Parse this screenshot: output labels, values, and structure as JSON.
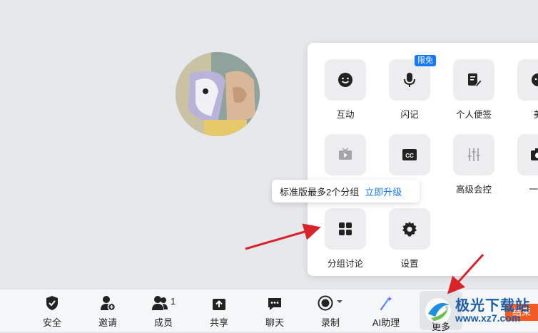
{
  "panel": {
    "tiles": [
      {
        "label": "互动",
        "icon": "smile-icon"
      },
      {
        "label": "闪记",
        "icon": "mic-icon",
        "badge": "限免"
      },
      {
        "label": "个人便签",
        "icon": "note-edit-icon"
      },
      {
        "label": "美",
        "icon": "beauty-icon"
      },
      {
        "label": "",
        "icon": "tv-play-icon"
      },
      {
        "label": "",
        "icon": "cc-icon"
      },
      {
        "label": "高级会控",
        "icon": "sliders-icon"
      },
      {
        "label": "一键",
        "icon": "camera-icon"
      },
      {
        "label": "分组讨论",
        "icon": "grid-icon"
      },
      {
        "label": "设置",
        "icon": "gear-icon"
      }
    ]
  },
  "tooltip": {
    "text": "标准版最多2个分组",
    "link": "立即升级"
  },
  "toolbar": {
    "items": [
      {
        "label": "安全",
        "icon": "shield-check-icon"
      },
      {
        "label": "邀请",
        "icon": "add-user-icon"
      },
      {
        "label": "成员",
        "icon": "members-icon",
        "count": "1"
      },
      {
        "label": "共享",
        "icon": "share-screen-icon"
      },
      {
        "label": "聊天",
        "icon": "chat-icon"
      },
      {
        "label": "录制",
        "icon": "record-icon"
      },
      {
        "label": "AI助理",
        "icon": "ai-sparkle-icon"
      },
      {
        "label": "更多",
        "icon": "more-dots-icon"
      }
    ],
    "end_label": "结束"
  },
  "watermark": {
    "brand": "极光下载站",
    "url": "www.xz7.com"
  },
  "colors": {
    "accent": "#1677ff",
    "end": "#f05a23",
    "arrow": "#d9232a"
  }
}
